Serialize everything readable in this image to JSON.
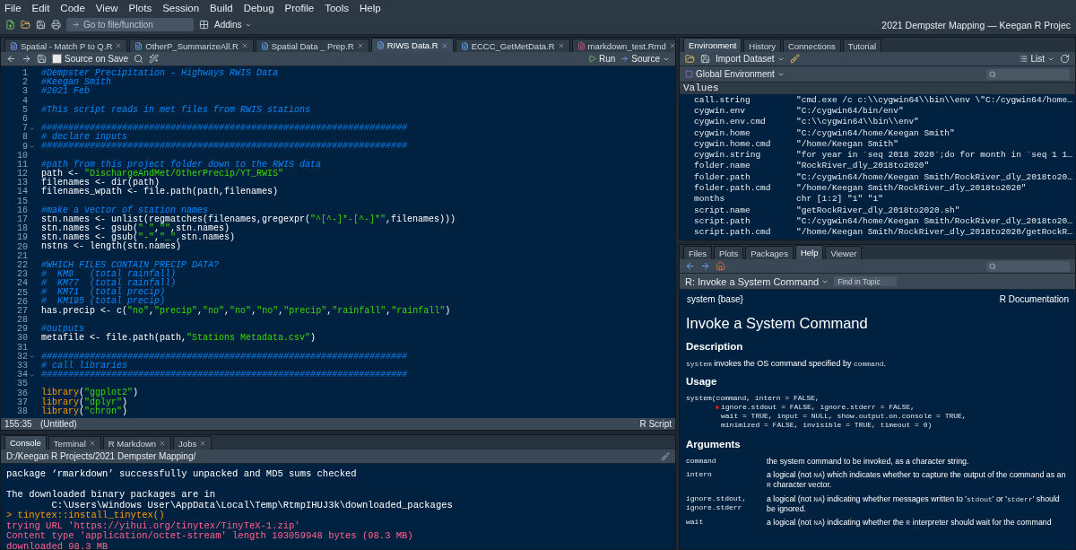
{
  "menu": [
    "File",
    "Edit",
    "Code",
    "View",
    "Plots",
    "Session",
    "Build",
    "Debug",
    "Profile",
    "Tools",
    "Help"
  ],
  "toolbar": {
    "goto_placeholder": "Go to file/function",
    "addins": "Addins",
    "project": "2021 Dempster Mapping — Keegan R Projec"
  },
  "editor": {
    "tabs": [
      {
        "label": "Spatial - Match P to Q.R",
        "selected": false,
        "kind": "r"
      },
      {
        "label": "OtherP_SummarizeAll.R",
        "selected": false,
        "kind": "r"
      },
      {
        "label": "Spatial Data _ Prep.R",
        "selected": false,
        "kind": "r"
      },
      {
        "label": "RIWS Data.R",
        "selected": true,
        "kind": "r"
      },
      {
        "label": "ECCC_GetMetData.R",
        "selected": false,
        "kind": "r"
      },
      {
        "label": "markdown_test.Rmd",
        "selected": false,
        "kind": "rmd"
      }
    ],
    "source_on_save": {
      "label": "Source on Save",
      "checked": false
    },
    "run": "Run",
    "source": "Source",
    "lines": [
      {
        "n": "1",
        "fold": false,
        "tokens": [
          {
            "kind": "comment",
            "t": "#Dempster Precipitation - Highways RWIS Data"
          }
        ]
      },
      {
        "n": "2",
        "fold": false,
        "tokens": [
          {
            "kind": "comment",
            "t": "#Keegan Smith"
          }
        ]
      },
      {
        "n": "3",
        "fold": false,
        "tokens": [
          {
            "kind": "comment",
            "t": "#2021 Feb"
          }
        ]
      },
      {
        "n": "4",
        "fold": false
      },
      {
        "n": "5",
        "fold": false,
        "tokens": [
          {
            "kind": "comment",
            "t": "#This script reads in met files from RWIS stations"
          }
        ]
      },
      {
        "n": "6",
        "fold": false
      },
      {
        "n": "7",
        "fold": true,
        "tokens": [
          {
            "kind": "comment",
            "t": "####################################################################"
          }
        ]
      },
      {
        "n": "8",
        "fold": false,
        "tokens": [
          {
            "kind": "comment",
            "t": "# declare inputs"
          }
        ]
      },
      {
        "n": "9",
        "fold": true,
        "tokens": [
          {
            "kind": "comment",
            "t": "####################################################################"
          }
        ]
      },
      {
        "n": "10",
        "fold": false
      },
      {
        "n": "11",
        "fold": false,
        "tokens": [
          {
            "kind": "comment",
            "t": "#path from this project folder down to the RWIS data"
          }
        ]
      },
      {
        "n": "12",
        "fold": false,
        "tokens": [
          {
            "kind": "plain",
            "t": "path <- "
          },
          {
            "kind": "string",
            "t": "\"DischargeAndMet/OtherPrecip/YT_RWIS\""
          }
        ]
      },
      {
        "n": "13",
        "fold": false,
        "tokens": [
          {
            "kind": "plain",
            "t": "filenames <- dir(path)"
          }
        ]
      },
      {
        "n": "14",
        "fold": false,
        "tokens": [
          {
            "kind": "plain",
            "t": "filenames_wpath <- file.path(path,filenames)"
          }
        ]
      },
      {
        "n": "15",
        "fold": false
      },
      {
        "n": "16",
        "fold": false,
        "tokens": [
          {
            "kind": "comment",
            "t": "#make a vector of station names"
          }
        ]
      },
      {
        "n": "17",
        "fold": false,
        "tokens": [
          {
            "kind": "plain",
            "t": "stn.names <- unlist(regmatches(filenames,gregexpr("
          },
          {
            "kind": "string",
            "t": "\"^[^-]*-[^-]*\""
          },
          {
            "kind": "plain",
            "t": ",filenames)))"
          }
        ]
      },
      {
        "n": "18",
        "fold": false,
        "tokens": [
          {
            "kind": "plain",
            "t": "stn.names <- gsub("
          },
          {
            "kind": "string",
            "t": "\" \""
          },
          {
            "kind": "plain",
            "t": ","
          },
          {
            "kind": "string",
            "t": "\"\""
          },
          {
            "kind": "plain",
            "t": ",stn.names)"
          }
        ]
      },
      {
        "n": "19",
        "fold": false,
        "tokens": [
          {
            "kind": "plain",
            "t": "stn.names <- gsub("
          },
          {
            "kind": "string",
            "t": "\"-\""
          },
          {
            "kind": "plain",
            "t": ","
          },
          {
            "kind": "string",
            "t": "\"_\""
          },
          {
            "kind": "plain",
            "t": ",stn.names)"
          }
        ]
      },
      {
        "n": "20",
        "fold": false,
        "tokens": [
          {
            "kind": "plain",
            "t": "nstns <- length(stn.names)"
          }
        ]
      },
      {
        "n": "21",
        "fold": false
      },
      {
        "n": "22",
        "fold": false,
        "tokens": [
          {
            "kind": "comment",
            "t": "#WHICH FILES CONTAIN PRECIP DATA?"
          }
        ]
      },
      {
        "n": "23",
        "fold": false,
        "tokens": [
          {
            "kind": "comment",
            "t": "#  KM8   (total rainfall)"
          }
        ]
      },
      {
        "n": "24",
        "fold": false,
        "tokens": [
          {
            "kind": "comment",
            "t": "#  KM77  (total rainfall)"
          }
        ]
      },
      {
        "n": "25",
        "fold": false,
        "tokens": [
          {
            "kind": "comment",
            "t": "#  KM71  (total precip)"
          }
        ]
      },
      {
        "n": "26",
        "fold": false,
        "tokens": [
          {
            "kind": "comment",
            "t": "#  KM195 (total precip)"
          }
        ]
      },
      {
        "n": "27",
        "fold": false,
        "tokens": [
          {
            "kind": "plain",
            "t": "has.precip <- c("
          },
          {
            "kind": "string",
            "t": "\"no\""
          },
          {
            "kind": "plain",
            "t": ","
          },
          {
            "kind": "string",
            "t": "\"precip\""
          },
          {
            "kind": "plain",
            "t": ","
          },
          {
            "kind": "string",
            "t": "\"no\""
          },
          {
            "kind": "plain",
            "t": ","
          },
          {
            "kind": "string",
            "t": "\"no\""
          },
          {
            "kind": "plain",
            "t": ","
          },
          {
            "kind": "string",
            "t": "\"no\""
          },
          {
            "kind": "plain",
            "t": ","
          },
          {
            "kind": "string",
            "t": "\"precip\""
          },
          {
            "kind": "plain",
            "t": ","
          },
          {
            "kind": "string",
            "t": "\"rainfall\""
          },
          {
            "kind": "plain",
            "t": ","
          },
          {
            "kind": "string",
            "t": "\"rainfall\""
          },
          {
            "kind": "plain",
            "t": ")"
          }
        ]
      },
      {
        "n": "28",
        "fold": false
      },
      {
        "n": "29",
        "fold": false,
        "tokens": [
          {
            "kind": "comment",
            "t": "#outputs"
          }
        ]
      },
      {
        "n": "30",
        "fold": false,
        "tokens": [
          {
            "kind": "plain",
            "t": "metafile <- file.path(path,"
          },
          {
            "kind": "string",
            "t": "\"Stations Metadata.csv\""
          },
          {
            "kind": "plain",
            "t": ")"
          }
        ]
      },
      {
        "n": "31",
        "fold": false
      },
      {
        "n": "32",
        "fold": true,
        "tokens": [
          {
            "kind": "comment",
            "t": "####################################################################"
          }
        ]
      },
      {
        "n": "33",
        "fold": false,
        "tokens": [
          {
            "kind": "comment",
            "t": "# call libraries"
          }
        ]
      },
      {
        "n": "34",
        "fold": true,
        "tokens": [
          {
            "kind": "comment",
            "t": "####################################################################"
          }
        ]
      },
      {
        "n": "35",
        "fold": false
      },
      {
        "n": "36",
        "fold": false,
        "tokens": [
          {
            "kind": "lib",
            "t": "library"
          },
          {
            "kind": "plain",
            "t": "("
          },
          {
            "kind": "string",
            "t": "\"ggplot2\""
          },
          {
            "kind": "plain",
            "t": ")"
          }
        ]
      },
      {
        "n": "37",
        "fold": false,
        "tokens": [
          {
            "kind": "lib",
            "t": "library"
          },
          {
            "kind": "plain",
            "t": "("
          },
          {
            "kind": "string",
            "t": "\"dplyr\""
          },
          {
            "kind": "plain",
            "t": ")"
          }
        ]
      },
      {
        "n": "38",
        "fold": false,
        "tokens": [
          {
            "kind": "lib",
            "t": "library"
          },
          {
            "kind": "plain",
            "t": "("
          },
          {
            "kind": "string",
            "t": "\"chron\""
          },
          {
            "kind": "plain",
            "t": ")"
          }
        ]
      }
    ],
    "status": {
      "position": "155:35",
      "scope": "(Untitled)",
      "type": "R Script"
    }
  },
  "console": {
    "tabs": [
      {
        "label": "Console",
        "selected": true,
        "closable": false
      },
      {
        "label": "Terminal",
        "selected": false,
        "closable": true
      },
      {
        "label": "R Markdown",
        "selected": false,
        "closable": true
      },
      {
        "label": "Jobs",
        "selected": false,
        "closable": true
      }
    ],
    "path": "D:/Keegan R Projects/2021 Dempster Mapping/",
    "lines": [
      {
        "kind": "output",
        "text": "package ‘rmarkdown’ successfully unpacked and MD5 sums checked"
      },
      {
        "kind": "blank"
      },
      {
        "kind": "output",
        "text": "The downloaded binary packages are in"
      },
      {
        "kind": "output",
        "text": "        C:\\Users\\Windows User\\AppData\\Local\\Temp\\RtmpIHUJ3k\\downloaded_packages"
      },
      {
        "kind": "input",
        "text": "> tinytex::install_tinytex()"
      },
      {
        "kind": "message",
        "text": "trying URL 'https://yihui.org/tinytex/TinyTeX-1.zip'"
      },
      {
        "kind": "message",
        "text": "Content type 'application/octet-stream' length 103059948 bytes (98.3 MB)"
      },
      {
        "kind": "message",
        "text": "downloaded 98.3 MB"
      }
    ]
  },
  "environment": {
    "tabs": [
      {
        "label": "Environment",
        "selected": true
      },
      {
        "label": "History",
        "selected": false
      },
      {
        "label": "Connections",
        "selected": false
      },
      {
        "label": "Tutorial",
        "selected": false
      }
    ],
    "import": "Import Dataset",
    "view": "List",
    "scope": "Global Environment",
    "section": "Values",
    "rows": [
      {
        "name": "call.string",
        "value": "\"cmd.exe /c c:\\\\cygwin64\\\\bin\\\\env \\\"C:/cygwin64/home…"
      },
      {
        "name": "cygwin.env",
        "value": "\"C:/cygwin64/bin/env\""
      },
      {
        "name": "cygwin.env.cmd",
        "value": "\"c:\\\\cygwin64\\\\bin\\\\env\""
      },
      {
        "name": "cygwin.home",
        "value": "\"C:/cygwin64/home/Keegan Smith\""
      },
      {
        "name": "cygwin.home.cmd",
        "value": "\"/home/Keegan Smith\""
      },
      {
        "name": "cygwin.string",
        "value": "\"for year in `seq 2018 2020`;do for month in `seq 1 1…"
      },
      {
        "name": "folder.name",
        "value": "\"RockRiver_dly_2018to2020\""
      },
      {
        "name": "folder.path",
        "value": "\"C:/cygwin64/home/Keegan Smith/RockRiver_dly_2018to20…"
      },
      {
        "name": "folder.path.cmd",
        "value": "\"/home/Keegan Smith/RockRiver_dly_2018to2020\""
      },
      {
        "name": "months",
        "value": "chr [1:2] \"1\" \"1\""
      },
      {
        "name": "script.name",
        "value": "\"getRockRiver_dly_2018to2020.sh\""
      },
      {
        "name": "script.path",
        "value": "\"C:/cygwin64/home/Keegan Smith/RockRiver_dly_2018to20…"
      },
      {
        "name": "script.path.cmd",
        "value": "\"/home/Keegan Smith/RockRiver_dly_2018to2020/getRockR…"
      }
    ]
  },
  "help": {
    "tabs": [
      {
        "label": "Files",
        "selected": false
      },
      {
        "label": "Plots",
        "selected": false
      },
      {
        "label": "Packages",
        "selected": false
      },
      {
        "label": "Help",
        "selected": true
      },
      {
        "label": "Viewer",
        "selected": false
      }
    ],
    "topic": "R: Invoke a System Command",
    "find_placeholder": "Find in Topic",
    "package": "system {base}",
    "doc": "R Documentation",
    "title": "Invoke a System Command",
    "description_heading": "Description",
    "description": [
      {
        "t": "system",
        "code": true
      },
      {
        "t": " invokes the OS command specified by ",
        "code": false
      },
      {
        "t": "command",
        "code": true
      },
      {
        "t": ".",
        "code": false
      }
    ],
    "usage_heading": "Usage",
    "usage": [
      {
        "text": "system(command, intern = FALSE,",
        "marked": false,
        "indent": false
      },
      {
        "text": "ignore.stdout = FALSE, ignore.stderr = FALSE,",
        "marked": true,
        "indent": true
      },
      {
        "text": "wait = TRUE, input = NULL, show.output.on.console = TRUE,",
        "marked": false,
        "indent": true
      },
      {
        "text": "minimized = FALSE, invisible = TRUE, timeout = 0)",
        "marked": false,
        "indent": true
      }
    ],
    "arguments_heading": "Arguments",
    "arguments": [
      {
        "names": [
          "command"
        ],
        "desc": [
          {
            "t": "the system command to be invoked, as a character string.",
            "code": false
          }
        ]
      },
      {
        "names": [
          "intern"
        ],
        "desc": [
          {
            "t": "a logical (not ",
            "code": false
          },
          {
            "t": "NA",
            "code": true
          },
          {
            "t": ") which indicates whether to capture the output of the command as an ",
            "code": false
          },
          {
            "t": "R",
            "code": true
          },
          {
            "t": " character vector.",
            "code": false
          }
        ]
      },
      {
        "names": [
          "ignore.stdout,",
          "ignore.stderr"
        ],
        "desc": [
          {
            "t": "a logical (not ",
            "code": false
          },
          {
            "t": "NA",
            "code": true
          },
          {
            "t": ") indicating whether messages written to '",
            "code": false
          },
          {
            "t": "stdout",
            "code": true
          },
          {
            "t": "' or '",
            "code": false
          },
          {
            "t": "stderr",
            "code": true
          },
          {
            "t": "' should be ignored.",
            "code": false
          }
        ]
      },
      {
        "names": [
          "wait"
        ],
        "desc": [
          {
            "t": "a logical (not ",
            "code": false
          },
          {
            "t": "NA",
            "code": true
          },
          {
            "t": ") indicating whether the ",
            "code": false
          },
          {
            "t": "R",
            "code": true
          },
          {
            "t": " interpreter should wait for the command",
            "code": false
          }
        ]
      }
    ]
  }
}
